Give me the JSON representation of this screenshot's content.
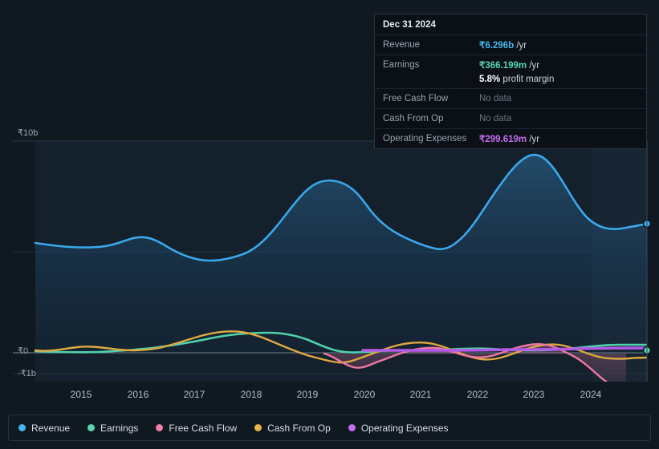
{
  "tooltip": {
    "date": "Dec 31 2024",
    "rows": [
      {
        "name": "Revenue",
        "value": "₹6.296b",
        "unit": "/yr",
        "color": "#45b6f0",
        "nodata": false
      },
      {
        "name": "Earnings",
        "value": "₹366.199m",
        "unit": "/yr",
        "color": "#57d6ae",
        "nodata": false
      },
      {
        "name": "Free Cash Flow",
        "value": "No data",
        "unit": "",
        "color": "#6b7682",
        "nodata": true
      },
      {
        "name": "Cash From Op",
        "value": "No data",
        "unit": "",
        "color": "#6b7682",
        "nodata": true
      },
      {
        "name": "Operating Expenses",
        "value": "₹299.619m",
        "unit": "/yr",
        "color": "#c36df0",
        "nodata": false
      }
    ],
    "margin_value": "5.8%",
    "margin_label": "profit margin"
  },
  "axis": {
    "y_top": "₹10b",
    "y_zero": "₹0",
    "y_neg": "-₹1b",
    "x_ticks": [
      "2015",
      "2016",
      "2017",
      "2018",
      "2019",
      "2020",
      "2021",
      "2022",
      "2023",
      "2024"
    ]
  },
  "legend": [
    {
      "label": "Revenue",
      "color": "#45b6f0"
    },
    {
      "label": "Earnings",
      "color": "#57d6ae"
    },
    {
      "label": "Free Cash Flow",
      "color": "#f07ca8"
    },
    {
      "label": "Cash From Op",
      "color": "#e8b44a"
    },
    {
      "label": "Operating Expenses",
      "color": "#c36df0"
    }
  ],
  "chart_data": {
    "type": "area",
    "title": "",
    "xlabel": "",
    "ylabel": "",
    "ylim": [
      -1000000000,
      10000000000
    ],
    "y_ticks": [
      -1000000000,
      0,
      10000000000
    ],
    "y_tick_labels": [
      "-₹1b",
      "₹0",
      "₹10b"
    ],
    "grid": true,
    "legend_position": "bottom",
    "currency": "INR",
    "x": [
      "2014.4",
      "2014.7",
      "2015.0",
      "2015.3",
      "2015.6",
      "2015.9",
      "2016.2",
      "2016.5",
      "2016.8",
      "2017.1",
      "2017.4",
      "2017.7",
      "2018.0",
      "2018.3",
      "2018.6",
      "2018.9",
      "2019.2",
      "2019.5",
      "2019.8",
      "2020.1",
      "2020.4",
      "2020.7",
      "2021.0",
      "2021.3",
      "2021.6",
      "2021.9",
      "2022.2",
      "2022.5",
      "2022.8",
      "2023.1",
      "2023.4",
      "2023.7",
      "2024.0",
      "2024.3",
      "2024.6",
      "2024.9",
      "2025.0"
    ],
    "series": [
      {
        "name": "Revenue",
        "color": "#45b6f0",
        "values": [
          5.05,
          4.88,
          4.82,
          4.82,
          4.95,
          4.85,
          4.78,
          4.8,
          4.35,
          3.95,
          3.8,
          3.78,
          4.1,
          4.65,
          5.55,
          6.6,
          7.3,
          7.25,
          6.85,
          6.45,
          6.25,
          5.85,
          5.5,
          5.7,
          6.6,
          7.7,
          8.4,
          8.85,
          8.7,
          7.85,
          6.8,
          6.1,
          5.9,
          5.95,
          6.1,
          6.296,
          6.296
        ],
        "unit": "billion INR"
      },
      {
        "name": "Earnings",
        "color": "#57d6ae",
        "values": [
          0.02,
          0.01,
          0.01,
          0.0,
          0.01,
          0.02,
          0.03,
          0.05,
          0.06,
          0.07,
          0.12,
          0.22,
          0.33,
          0.4,
          0.44,
          0.45,
          0.44,
          0.38,
          0.22,
          0.08,
          0.1,
          0.12,
          0.15,
          0.18,
          0.2,
          0.22,
          0.25,
          0.24,
          0.2,
          0.16,
          0.14,
          0.18,
          0.26,
          0.32,
          0.35,
          0.366,
          0.366
        ],
        "unit": "billion INR"
      },
      {
        "name": "Free Cash Flow",
        "color": "#f07ca8",
        "values": [
          null,
          null,
          null,
          null,
          null,
          null,
          null,
          null,
          null,
          null,
          null,
          null,
          null,
          null,
          null,
          null,
          null,
          -0.05,
          -0.4,
          -0.55,
          -0.3,
          -0.12,
          0.02,
          0.1,
          0.18,
          0.1,
          -0.05,
          -0.18,
          -0.12,
          0.05,
          0.12,
          0.28,
          0.36,
          0.18,
          -0.3,
          -0.95,
          -1.0
        ],
        "unit": "billion INR"
      },
      {
        "name": "Cash From Op",
        "color": "#e8b44a",
        "values": [
          0.04,
          0.02,
          0.03,
          0.06,
          0.09,
          0.08,
          0.05,
          0.04,
          0.02,
          0.03,
          0.1,
          0.22,
          0.36,
          0.44,
          0.47,
          0.45,
          0.38,
          0.26,
          0.05,
          -0.22,
          -0.12,
          0.05,
          0.18,
          0.3,
          0.4,
          0.34,
          0.18,
          0.0,
          -0.12,
          0.05,
          0.16,
          0.34,
          0.42,
          0.26,
          0.1,
          0.05,
          0.05
        ],
        "unit": "billion INR"
      },
      {
        "name": "Operating Expenses",
        "color": "#c36df0",
        "values": [
          null,
          null,
          null,
          null,
          null,
          null,
          null,
          null,
          null,
          null,
          null,
          null,
          null,
          null,
          null,
          null,
          null,
          null,
          null,
          0.2,
          0.2,
          0.2,
          0.2,
          0.21,
          0.21,
          0.21,
          0.22,
          0.22,
          0.23,
          0.24,
          0.25,
          0.27,
          0.29,
          0.29,
          0.3,
          0.2996,
          0.2996
        ],
        "unit": "billion INR"
      }
    ],
    "highlight_marker": {
      "x": "2024.9",
      "series": [
        "Revenue",
        "Earnings"
      ]
    }
  }
}
